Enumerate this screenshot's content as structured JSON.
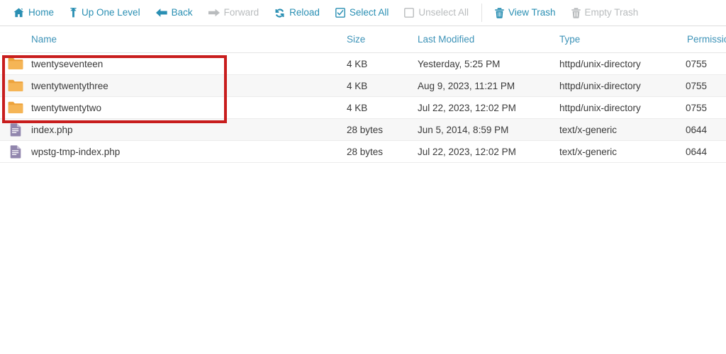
{
  "toolbar": {
    "buttons": [
      {
        "label": "Home",
        "icon": "home-icon",
        "enabled": true
      },
      {
        "label": "Up One Level",
        "icon": "arrow-up-icon",
        "enabled": true
      },
      {
        "label": "Back",
        "icon": "arrow-left-icon",
        "enabled": true
      },
      {
        "label": "Forward",
        "icon": "arrow-right-icon",
        "enabled": false
      },
      {
        "label": "Reload",
        "icon": "reload-icon",
        "enabled": true
      },
      {
        "label": "Select All",
        "icon": "checkbox-checked-icon",
        "enabled": true
      },
      {
        "label": "Unselect All",
        "icon": "checkbox-empty-icon",
        "enabled": false
      },
      {
        "label": "View Trash",
        "icon": "trash-icon",
        "enabled": true
      },
      {
        "label": "Empty Trash",
        "icon": "trash-icon",
        "enabled": false
      }
    ],
    "separator_after_index": 6
  },
  "table": {
    "columns": [
      "Name",
      "Size",
      "Last Modified",
      "Type",
      "Permissions"
    ],
    "rows": [
      {
        "icon": "folder-icon",
        "name": "twentyseventeen",
        "size": "4 KB",
        "modified": "Yesterday, 5:25 PM",
        "type": "httpd/unix-directory",
        "permissions": "0755"
      },
      {
        "icon": "folder-icon",
        "name": "twentytwentythree",
        "size": "4 KB",
        "modified": "Aug 9, 2023, 11:21 PM",
        "type": "httpd/unix-directory",
        "permissions": "0755"
      },
      {
        "icon": "folder-icon",
        "name": "twentytwentytwo",
        "size": "4 KB",
        "modified": "Jul 22, 2023, 12:02 PM",
        "type": "httpd/unix-directory",
        "permissions": "0755"
      },
      {
        "icon": "file-icon",
        "name": "index.php",
        "size": "28 bytes",
        "modified": "Jun 5, 2014, 8:59 PM",
        "type": "text/x-generic",
        "permissions": "0644"
      },
      {
        "icon": "file-icon",
        "name": "wpstg-tmp-index.php",
        "size": "28 bytes",
        "modified": "Jul 22, 2023, 12:02 PM",
        "type": "text/x-generic",
        "permissions": "0644"
      }
    ]
  },
  "annotation": {
    "highlight_color": "#c81d1d",
    "label": "folder-rows-highlight"
  },
  "colors": {
    "accent": "#2a8fb3",
    "header_text": "#3d93b8",
    "disabled": "#b9bcbe",
    "folder": "#f0a43a",
    "file": "#8b7aa8"
  }
}
